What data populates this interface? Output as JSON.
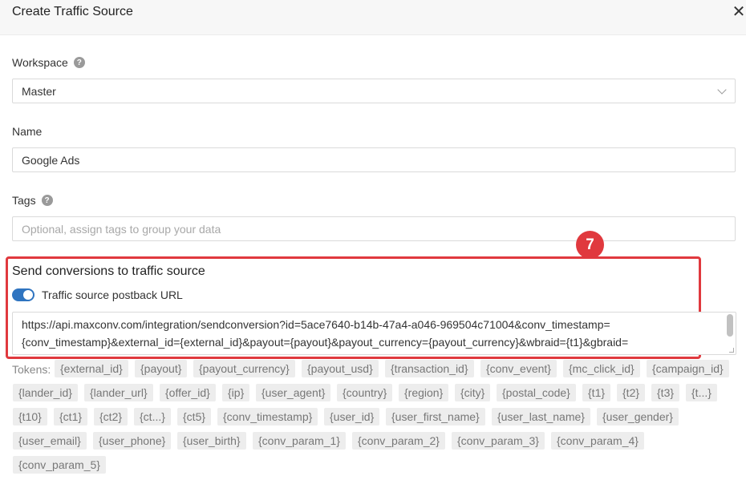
{
  "modal": {
    "title": "Create Traffic Source",
    "close_symbol": "✕"
  },
  "workspace": {
    "label": "Workspace",
    "value": "Master"
  },
  "name": {
    "label": "Name",
    "value": "Google Ads"
  },
  "tags": {
    "label": "Tags",
    "placeholder": "Optional, assign tags to group your data"
  },
  "step_badge": "7",
  "conversions": {
    "title": "Send conversions to traffic source",
    "toggle_label": "Traffic source postback URL",
    "toggle_on": true,
    "url_line_1": "https://api.maxconv.com/integration/sendconversion?id=5ace7640-b14b-47a4-a046-969504c71004&conv_timestamp=",
    "url_line_2": "{conv_timestamp}&external_id={external_id}&payout={payout}&payout_currency={payout_currency}&wbraid={t1}&gbraid="
  },
  "tokens": {
    "label": "Tokens:",
    "items": [
      "{external_id}",
      "{payout}",
      "{payout_currency}",
      "{payout_usd}",
      "{transaction_id}",
      "{conv_event}",
      "{mc_click_id}",
      "{campaign_id}",
      "{lander_id}",
      "{lander_url}",
      "{offer_id}",
      "{ip}",
      "{user_agent}",
      "{country}",
      "{region}",
      "{city}",
      "{postal_code}",
      "{t1}",
      "{t2}",
      "{t3}",
      "{t...}",
      "{t10}",
      "{ct1}",
      "{ct2}",
      "{ct...}",
      "{ct5}",
      "{conv_timestamp}",
      "{user_id}",
      "{user_first_name}",
      "{user_last_name}",
      "{user_gender}",
      "{user_email}",
      "{user_phone}",
      "{user_birth}",
      "{conv_param_1}",
      "{conv_param_2}",
      "{conv_param_3}",
      "{conv_param_4}",
      "{conv_param_5}"
    ]
  },
  "colors": {
    "accent": "#2f74c0",
    "highlight": "#e0393e"
  }
}
